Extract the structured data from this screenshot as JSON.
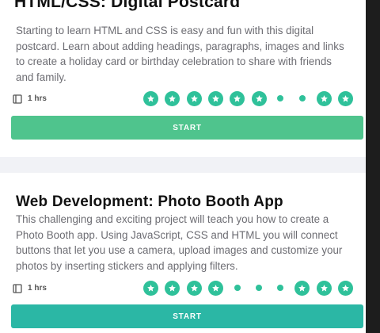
{
  "colors": {
    "page_bg": "#f1f2f6",
    "card_bg": "#ffffff",
    "progress": "#2fc19a",
    "start_button_1": "#4fc48d",
    "start_button_2": "#2bb7a5",
    "scrollbar": "#1d1d1d"
  },
  "courses": [
    {
      "title": "HTML/CSS: Digital Postcard",
      "description": "Starting to learn HTML and CSS is easy and fun with this digital postcard. Learn about adding headings, paragraphs, images and links to create a holiday card or birthday celebration to share with friends and family.",
      "duration_icon": "book-icon",
      "duration": "1 hrs",
      "progress_steps": [
        "star",
        "star",
        "star",
        "star",
        "star",
        "star",
        "dot",
        "dot",
        "star",
        "star"
      ],
      "start_label": "START"
    },
    {
      "title": "Web Development: Photo Booth App",
      "description": "This challenging and exciting project will teach you how to create a Photo Booth app. Using JavaScript, CSS and HTML you will connect buttons that let you use a camera, upload images and customize your photos by inserting stickers and applying filters.",
      "duration_icon": "book-icon",
      "duration": "1 hrs",
      "progress_steps": [
        "star",
        "star",
        "star",
        "star",
        "dot",
        "dot",
        "dot",
        "star",
        "star",
        "star"
      ],
      "start_label": "START"
    }
  ]
}
